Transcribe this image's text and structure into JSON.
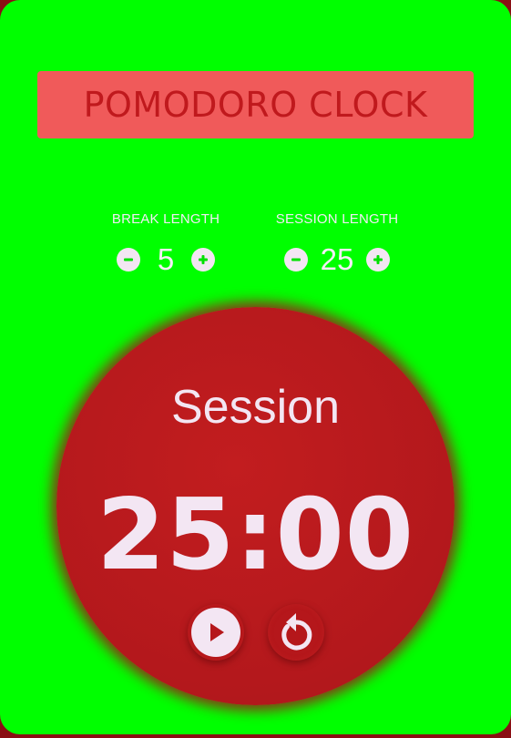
{
  "app": {
    "title": "POMODORO CLOCK"
  },
  "break": {
    "label": "BREAK LENGTH",
    "value": "5"
  },
  "session": {
    "label": "SESSION LENGTH",
    "value": "25"
  },
  "timer": {
    "mode_label": "Session",
    "time": "25:00"
  },
  "icons": {
    "decrement": "minus-circle-icon",
    "increment": "plus-circle-icon",
    "play": "play-icon",
    "reset": "reset-icon"
  },
  "colors": {
    "background": "#00ff00",
    "title_box": "#f05a5a",
    "title_text": "#c0191d",
    "timer_circle": "#b3181c",
    "light_text": "#f3e6f3"
  }
}
